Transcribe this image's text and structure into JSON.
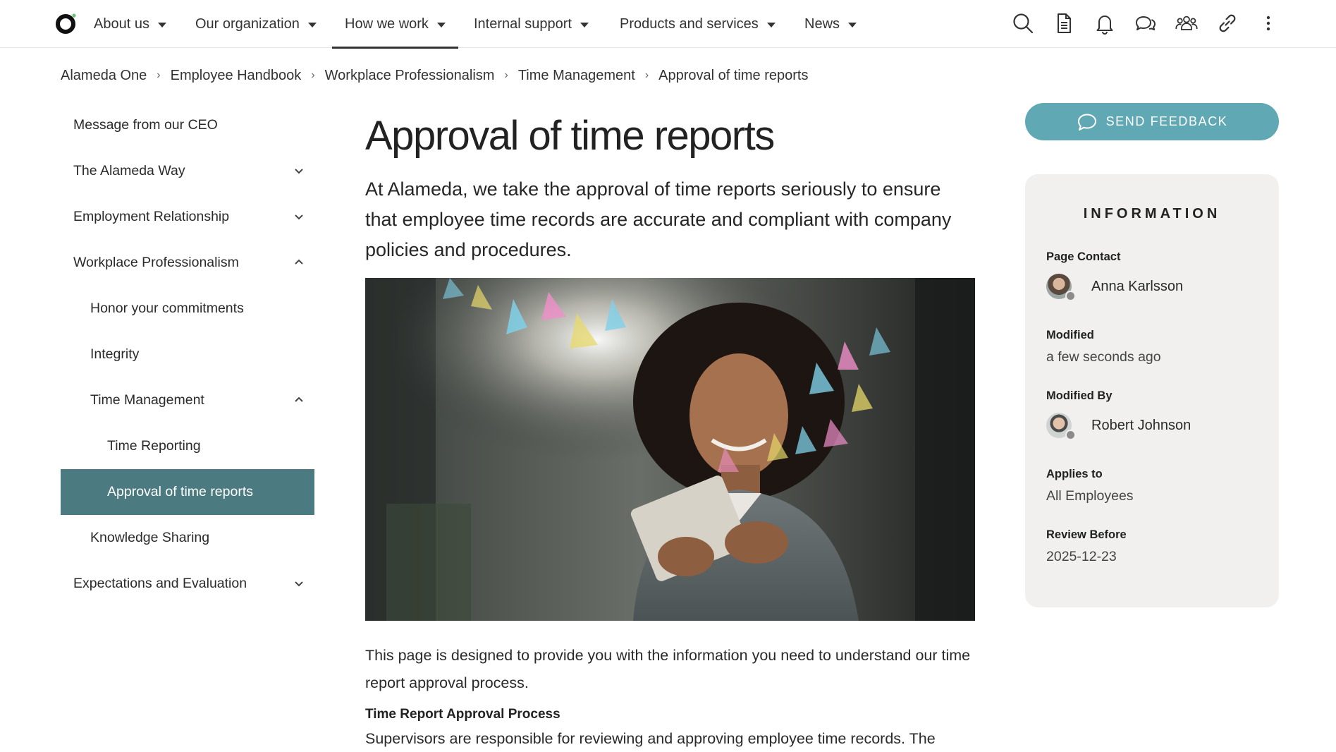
{
  "nav": {
    "items": [
      {
        "label": "About us"
      },
      {
        "label": "Our organization"
      },
      {
        "label": "How we work"
      },
      {
        "label": "Internal support"
      },
      {
        "label": "Products and services"
      },
      {
        "label": "News"
      }
    ],
    "active_index": 2,
    "tools": [
      "search-icon",
      "document-icon",
      "bell-icon",
      "chat-icon",
      "people-icon",
      "link-icon",
      "more-vertical-icon"
    ]
  },
  "breadcrumb": [
    "Alameda One",
    "Employee Handbook",
    "Workplace Professionalism",
    "Time Management",
    "Approval of time reports"
  ],
  "sidebar": {
    "items": [
      {
        "label": "Message from our CEO",
        "level": 1,
        "chevron": "none"
      },
      {
        "label": "The Alameda Way",
        "level": 1,
        "chevron": "down"
      },
      {
        "label": "Employment Relationship",
        "level": 1,
        "chevron": "down"
      },
      {
        "label": "Workplace Professionalism",
        "level": 1,
        "chevron": "up"
      },
      {
        "label": "Honor your commitments",
        "level": 2,
        "chevron": "none"
      },
      {
        "label": "Integrity",
        "level": 2,
        "chevron": "none"
      },
      {
        "label": "Time Management",
        "level": 2,
        "chevron": "up"
      },
      {
        "label": "Time Reporting",
        "level": 3,
        "chevron": "none"
      },
      {
        "label": "Approval of time reports",
        "level": 3,
        "chevron": "none",
        "selected": true
      },
      {
        "label": "Knowledge Sharing",
        "level": 2,
        "chevron": "none"
      },
      {
        "label": "Expectations and Evaluation",
        "level": 1,
        "chevron": "down"
      }
    ],
    "selected_color": "#4b7a80"
  },
  "main": {
    "title": "Approval of time reports",
    "lead": "At Alameda, we take the approval of time reports seriously to ensure that employee time records are accurate and compliant with company policies and procedures.",
    "body": "This page is designed to provide you with the information you need to understand our time report approval process.",
    "subheading": "Time Report Approval Process",
    "body2": "Supervisors are responsible for reviewing and approving employee time records. The"
  },
  "feedback": {
    "label": "SEND FEEDBACK",
    "color": "#5fa8b4"
  },
  "info": {
    "title": "INFORMATION",
    "page_contact_label": "Page Contact",
    "page_contact": "Anna Karlsson",
    "modified_label": "Modified",
    "modified": "a few seconds ago",
    "modified_by_label": "Modified By",
    "modified_by": "Robert Johnson",
    "applies_to_label": "Applies to",
    "applies_to": "All Employees",
    "review_before_label": "Review Before",
    "review_before": "2025-12-23"
  }
}
